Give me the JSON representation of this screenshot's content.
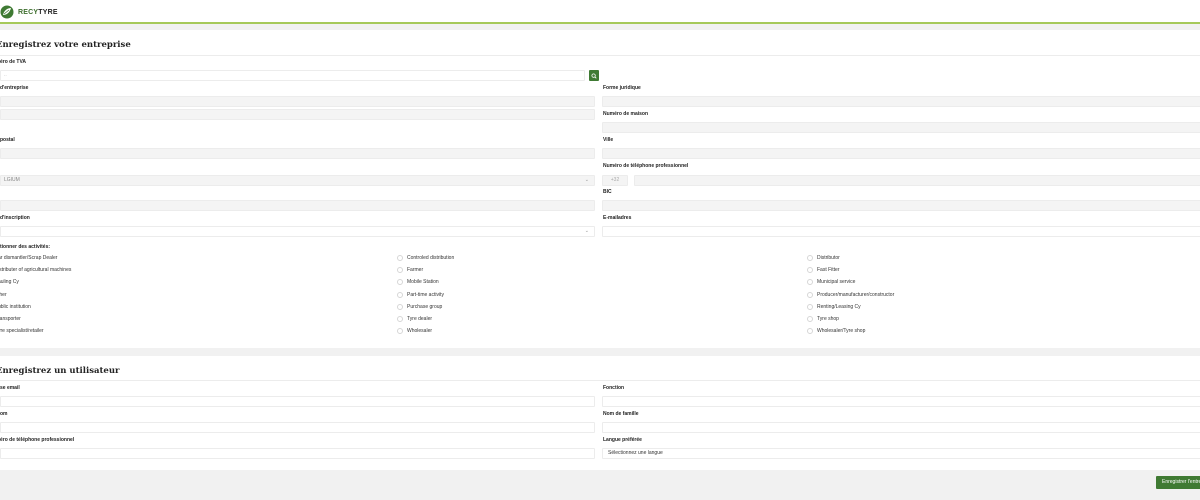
{
  "brand": {
    "name_prefix": "RECY",
    "name_suffix": "TYRE",
    "accent": "#3f7a33",
    "header_line": "#a6c95a"
  },
  "company_section": {
    "title": "Enregistrez votre entreprise",
    "vat_label": "éro de TVA",
    "vat_value": "",
    "company_name_label": "d'entreprise",
    "legal_form_label": "Forme juridique",
    "house_number_label": "Numéro de maison",
    "postal_label": "postal",
    "city_label": "Ville",
    "business_phone_label": "Numéro de téléphone professionnel",
    "country_value": "LGIUM",
    "phone_prefix": "+32",
    "bic_label": "BIC",
    "registration_label": "d'inscription",
    "email_label": "E-mailadres",
    "activities_label": "tionner des activités:",
    "activities_col1": [
      "ar dismantler/Scrap Dealer",
      "istributer of agricultural machines",
      "auling Cy",
      "ther",
      "ublic institution",
      "ransporter",
      "yre specialist/retailer"
    ],
    "activities_col2": [
      "Controled distribution",
      "Farmer",
      "Mobile Station",
      "Part-time activity",
      "Purchase group",
      "Tyre dealer",
      "Wholesaler"
    ],
    "activities_col3": [
      "Distributor",
      "Fast Fitter",
      "Municipal service",
      "Producer/manufacturer/constructor",
      "Renting/Leasing Cy",
      "Tyre shop",
      "Wholesaler/Tyre shop"
    ]
  },
  "user_section": {
    "title": "Enregistrez un utilisateur",
    "email_label": "se email",
    "function_label": "Fonction",
    "first_name_label": "om",
    "last_name_label": "Nom de famille",
    "phone_label": "éro de téléphone professionnel",
    "language_label": "Langue préférée",
    "language_placeholder": "Sélectionnez une langue"
  },
  "submit_label": "Enregistrer l'entreprise"
}
